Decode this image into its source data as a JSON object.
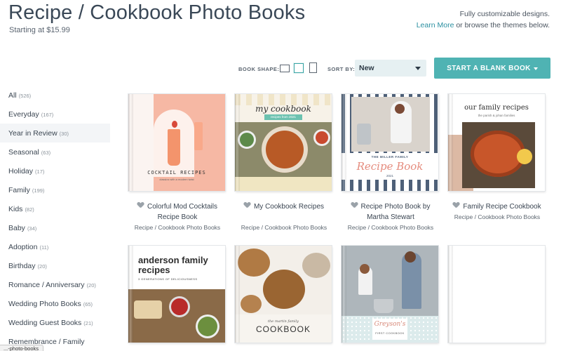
{
  "header": {
    "title": "Recipe / Cookbook Photo Books",
    "price": "Starting at $15.99",
    "promo_line1": "Fully customizable designs.",
    "learn_more": "Learn More",
    "promo_line2": " or browse the themes below."
  },
  "toolbar": {
    "book_shape_label": "BOOK SHAPE:",
    "shapes": [
      "landscape",
      "square",
      "portrait"
    ],
    "active_shape": "square",
    "sort_label": "SORT BY:",
    "sort_value": "New",
    "blank_button": "START A BLANK BOOK"
  },
  "sidebar": {
    "items": [
      {
        "label": "All",
        "count": "(526)"
      },
      {
        "label": "Everyday",
        "count": "(167)"
      },
      {
        "label": "Year in Review",
        "count": "(30)"
      },
      {
        "label": "Seasonal",
        "count": "(63)"
      },
      {
        "label": "Holiday",
        "count": "(17)"
      },
      {
        "label": "Family",
        "count": "(199)"
      },
      {
        "label": "Kids",
        "count": "(82)"
      },
      {
        "label": "Baby",
        "count": "(34)"
      },
      {
        "label": "Adoption",
        "count": "(11)"
      },
      {
        "label": "Birthday",
        "count": "(20)"
      },
      {
        "label": "Romance / Anniversary",
        "count": "(20)"
      },
      {
        "label": "Wedding Photo Books",
        "count": "(65)"
      },
      {
        "label": "Wedding Guest Books",
        "count": "(21)"
      },
      {
        "label": "Remembrance / Family",
        "count": ""
      }
    ],
    "active_index": 2
  },
  "books": [
    {
      "title": "Colorful Mod Cocktails Recipe Book",
      "category": "Recipe / Cookbook Photo Books",
      "cover_title": "COCKTAIL RECIPES",
      "cover_sub": "classics with a modern twist"
    },
    {
      "title": "My Cookbook Recipes",
      "category": "Recipe / Cookbook Photo Books",
      "cover_title": "my cookbook",
      "cover_sub": "recipes from 2021"
    },
    {
      "title": "Recipe Photo Book by Martha Stewart",
      "category": "Recipe / Cookbook Photo Books",
      "cover_title": "Recipe Book",
      "cover_kicker": "THE MILLER FAMILY",
      "cover_sub": "2021"
    },
    {
      "title": "Family Recipe Cookbook",
      "category": "Recipe / Cookbook Photo Books",
      "cover_title": "our family recipes",
      "cover_sub": "the parish & johan families"
    },
    {
      "cover_title": "anderson family recipes",
      "cover_sub": "3 GENERATIONS OF DELICIOUSNESS"
    },
    {
      "cover_title": "COOKBOOK",
      "cover_kicker": "the martin family"
    },
    {
      "cover_title": "Greyson's",
      "cover_sub": "FIRST COOKBOOK"
    },
    {}
  ],
  "status_tooltip": "...-photo-books",
  "colors": {
    "accent": "#4fb3b3",
    "link": "#2a8fa0",
    "title": "#3a4857"
  }
}
